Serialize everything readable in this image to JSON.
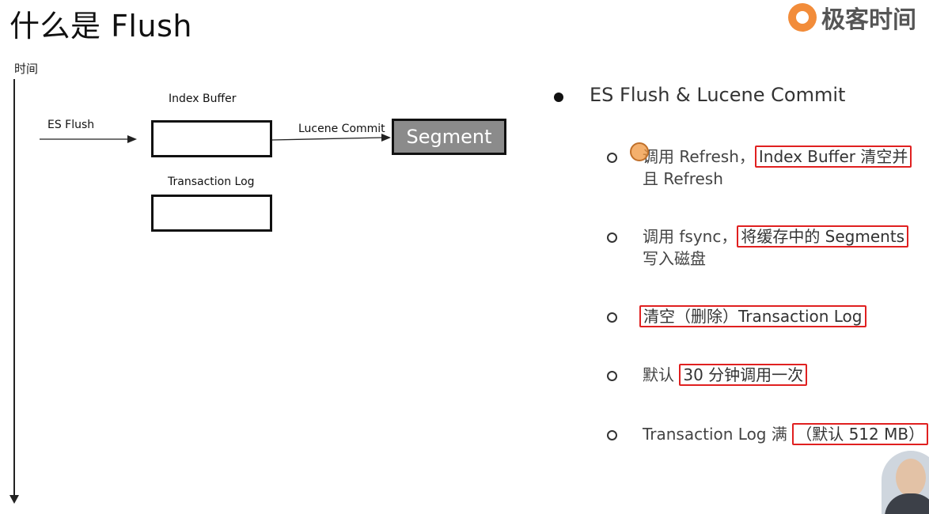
{
  "slide": {
    "title": "什么是 Flush"
  },
  "logo": {
    "text": "极客时间",
    "accent_color": "#f28c3a"
  },
  "timeline": {
    "label": "时间"
  },
  "diagram": {
    "es_flush": "ES Flush",
    "index_buffer": "Index Buffer",
    "lucene_commit": "Lucene Commit",
    "segment": "Segment",
    "transaction_log": "Transaction Log"
  },
  "bullets": {
    "main": "ES Flush & Lucene Commit",
    "items": [
      {
        "prefix": "调用 Refresh，",
        "highlight": "Index Buffer 清空并",
        "suffix": "且 Refresh"
      },
      {
        "prefix": "调用 fsync，",
        "highlight": "将缓存中的 Segments",
        "suffix": "写入磁盘"
      },
      {
        "prefix": "",
        "highlight": "清空（删除）Transaction Log",
        "suffix": ""
      },
      {
        "prefix": "默认 ",
        "highlight": "30 分钟调用一次",
        "suffix": ""
      },
      {
        "prefix": "Transaction Log 满 ",
        "highlight": "（默认 512 MB）",
        "suffix": ""
      }
    ],
    "highlight_color": "#e02020"
  }
}
